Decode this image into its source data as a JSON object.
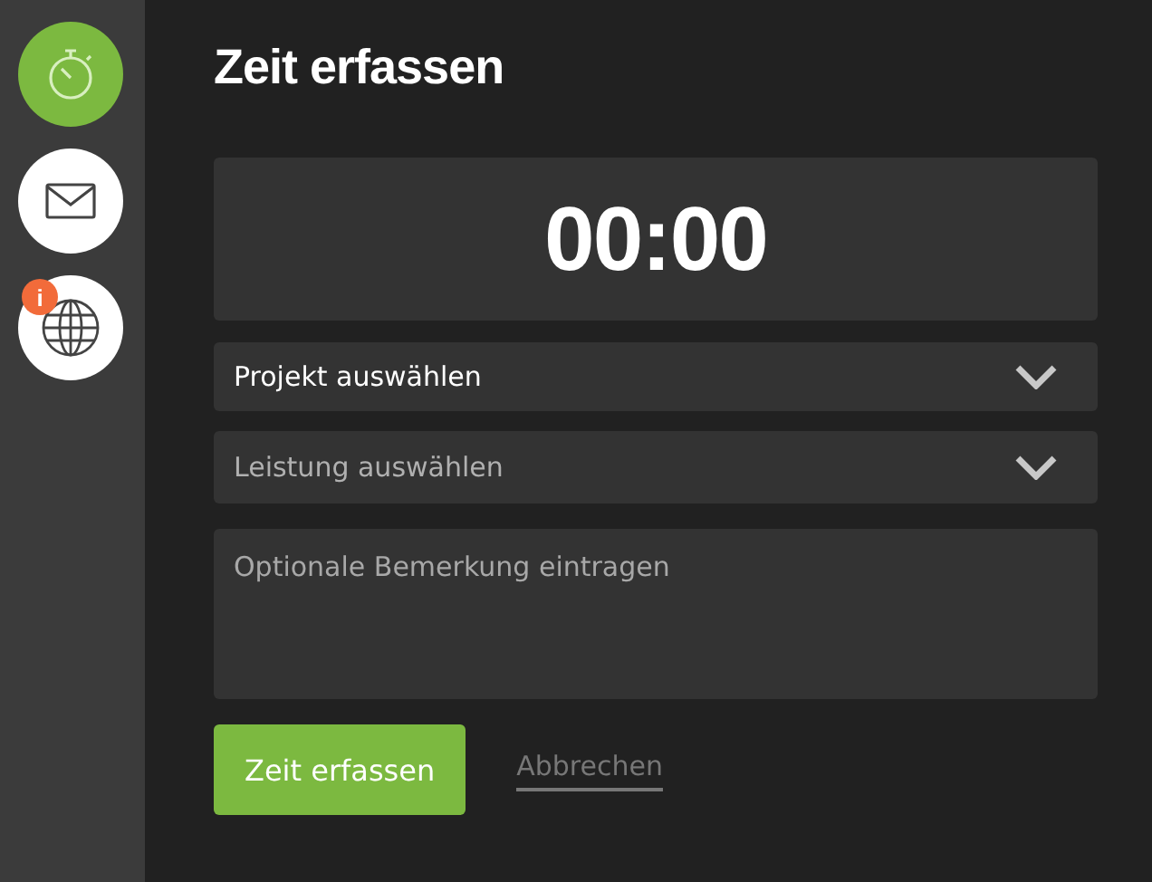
{
  "nav": [
    {
      "kind": "timer",
      "selected": true
    },
    {
      "kind": "mail",
      "selected": false
    },
    {
      "kind": "globe",
      "selected": false,
      "badge": "i"
    }
  ],
  "title": "Zeit erfassen",
  "timer": "00:00",
  "selects": [
    {
      "placeholder": "Projekt auswählen",
      "disabled": false
    },
    {
      "placeholder": "Leistung auswählen",
      "disabled": true
    }
  ],
  "remark": {
    "placeholder": "Optionale Bemerkung eintragen"
  },
  "buttons": {
    "submit": "Zeit erfassen",
    "cancel": "Abbrechen"
  }
}
